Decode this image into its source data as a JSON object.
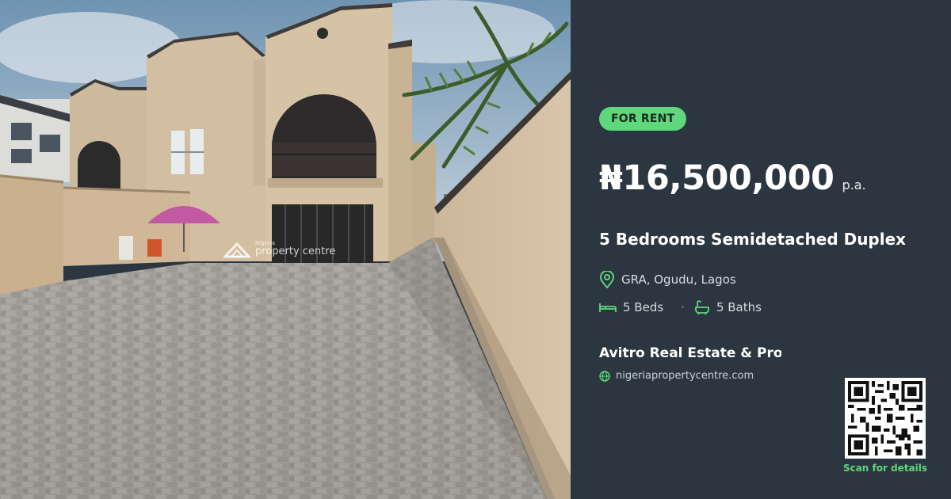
{
  "listing": {
    "status_badge": "FOR RENT",
    "price": "₦16,500,000",
    "price_period": "p.a.",
    "title": "5 Bedrooms Semidetached Duplex",
    "location": "GRA, Ogudu, Lagos",
    "beds": "5 Beds",
    "separator": "·",
    "baths": "5 Baths",
    "agent": "Avitro Real Estate & Pro...",
    "website": "nigeriapropertycentre.com",
    "qr_caption": "Scan for details"
  },
  "photo": {
    "watermark_top": "Nigeria",
    "watermark_bottom": "property centre"
  },
  "icons": {
    "location": "map-pin-icon",
    "beds": "bed-icon",
    "baths": "bathtub-icon",
    "website": "globe-icon"
  },
  "colors": {
    "panel_bg": "#2b3640",
    "accent_green": "#5fd77c",
    "text_primary": "#ffffff",
    "text_secondary": "#d6dde2"
  }
}
